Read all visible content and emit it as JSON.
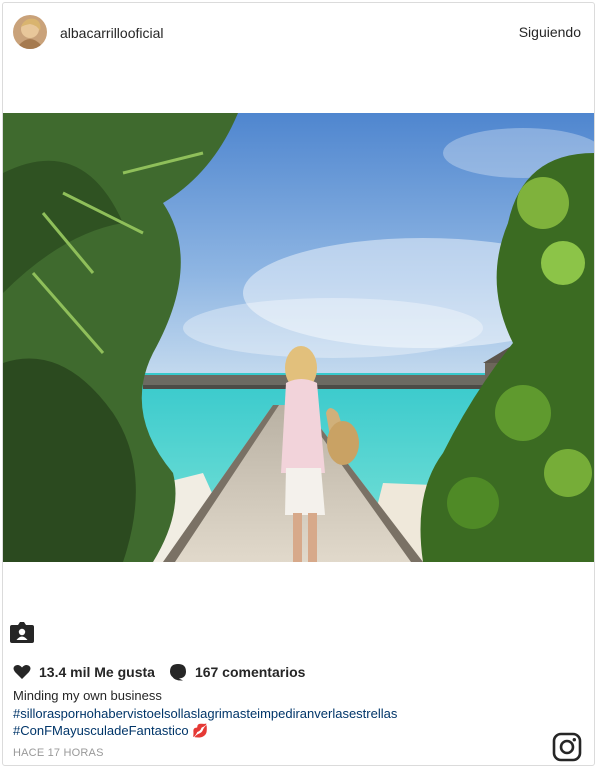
{
  "post": {
    "username": "albacarrillooficial",
    "follow_label": "Siguiendo",
    "likes_label": "13.4 mil Me gusta",
    "comments_label": "167 comentarios",
    "caption_text": "Minding my own business",
    "hashtag_1": "#sillorasporнohabervistoelsollaslagrimasteimpediranverlasestrellas",
    "hashtag_2": "#ConFMayusculadeFantastico 💋",
    "time_ago": "HACE 17 HORAS"
  },
  "icons": {
    "avatar": "profile-photo",
    "tag": "tagged-people-icon",
    "like": "heart-icon",
    "comment": "comment-bubble-icon",
    "brand": "instagram-logo-icon"
  },
  "colors": {
    "hashtag": "#003569",
    "muted": "#999999",
    "text": "#262626",
    "sea": "#3fd1cf",
    "sky": "#5b95d6"
  }
}
